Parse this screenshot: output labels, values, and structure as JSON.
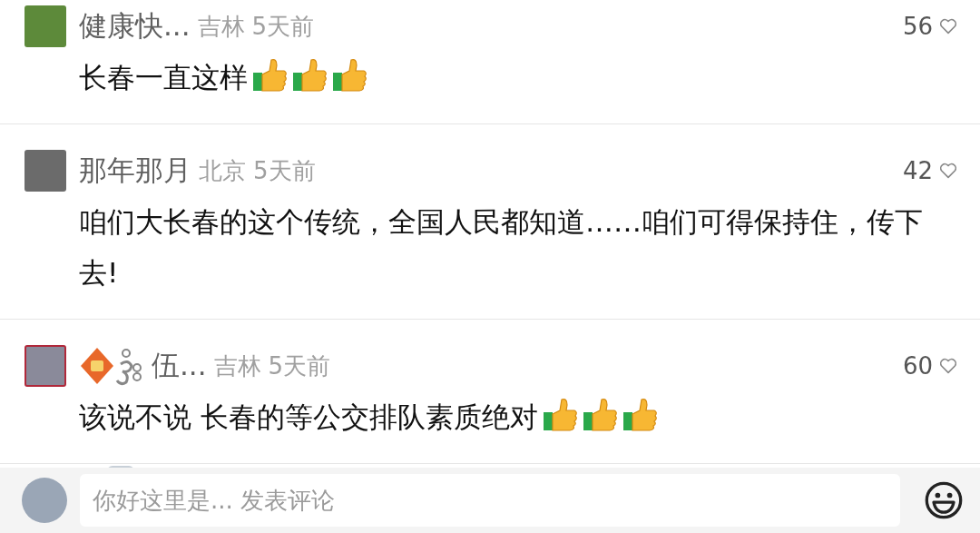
{
  "comments": [
    {
      "name": "健康快...",
      "name_badge": false,
      "location": "吉林",
      "time": "5天前",
      "likes": "56",
      "liked": false,
      "content": [
        {
          "kind": "text",
          "text": "长春一直这样"
        },
        {
          "kind": "thumbs-up"
        },
        {
          "kind": "thumbs-up"
        },
        {
          "kind": "thumbs-up"
        }
      ]
    },
    {
      "name": "那年那月",
      "name_badge": false,
      "location": "北京",
      "time": "5天前",
      "likes": "42",
      "liked": false,
      "content": [
        {
          "kind": "text",
          "text": "咱们大长春的这个传统，全国人民都知道……咱们可得保持住，传下去!"
        }
      ]
    },
    {
      "name": "伍...",
      "name_badge": true,
      "location": "吉林",
      "time": "5天前",
      "likes": "60",
      "liked": false,
      "content": [
        {
          "kind": "text",
          "text": "该说不说 长春的等公交排队素质绝对"
        },
        {
          "kind": "thumbs-up"
        },
        {
          "kind": "thumbs-up"
        },
        {
          "kind": "thumbs-up"
        }
      ]
    }
  ],
  "composer": {
    "placeholder": "你好这里是... 发表评论"
  }
}
